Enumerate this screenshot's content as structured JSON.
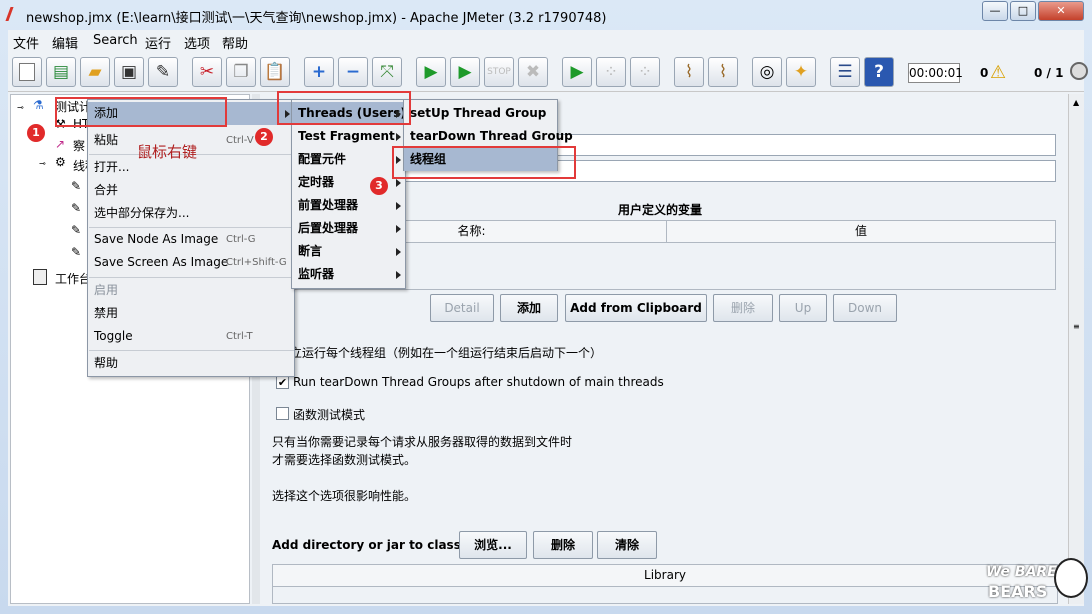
{
  "window": {
    "title": "newshop.jmx (E:\\learn\\接口测试\\一\\天气查询\\newshop.jmx) - Apache JMeter (3.2 r1790748)"
  },
  "menubar": [
    "文件",
    "编辑",
    "Search",
    "运行",
    "选项",
    "帮助"
  ],
  "toolbar": {
    "icons": [
      "new-icon",
      "templates-icon",
      "open-icon",
      "save-icon",
      "save-as-icon",
      "cut-icon",
      "copy-icon",
      "paste-icon",
      "expand-icon",
      "collapse-icon",
      "toggle-icon",
      "start-icon",
      "start-no-pause-icon",
      "stop-icon",
      "shutdown-icon",
      "remote-start-icon",
      "remote-stop-icon",
      "remote-shutdown-icon",
      "clear-icon",
      "clear-all-icon",
      "search-icon",
      "reset-search-icon",
      "function-helper-icon",
      "help-icon"
    ],
    "timer": "00:00:01",
    "warning_count": "0",
    "threads": "0 / 1"
  },
  "tree": {
    "nodes": [
      "测试计",
      "HT",
      "察",
      "线程",
      "工作台"
    ]
  },
  "context_menu": {
    "items": [
      {
        "label": "添加",
        "submenu": true
      },
      {
        "label": "粘贴",
        "shortcut": "Ctrl-V"
      },
      {
        "label": "打开..."
      },
      {
        "label": "合并"
      },
      {
        "label": "选中部分保存为..."
      },
      {
        "label": "Save Node As Image",
        "shortcut": "Ctrl-G"
      },
      {
        "label": "Save Screen As Image",
        "shortcut": "Ctrl+Shift-G"
      },
      {
        "label": "启用",
        "disabled": true
      },
      {
        "label": "禁用"
      },
      {
        "label": "Toggle",
        "shortcut": "Ctrl-T"
      },
      {
        "label": "帮助"
      }
    ]
  },
  "add_submenu": {
    "items": [
      "Threads (Users)",
      "Test Fragment",
      "配置元件",
      "定时器",
      "前置处理器",
      "后置处理器",
      "断言",
      "监听器"
    ]
  },
  "threads_submenu": {
    "items": [
      "setUp Thread Group",
      "tearDown Thread Group",
      "线程组"
    ]
  },
  "annotations": {
    "right_click_note": "鼠标右键",
    "badge1": "1",
    "badge2": "2",
    "badge3": "3"
  },
  "test_plan": {
    "variables_title": "用户定义的变量",
    "col_name": "名称:",
    "col_value": "值",
    "buttons": {
      "detail": "Detail",
      "add": "添加",
      "clipboard": "Add from Clipboard",
      "delete": "删除",
      "up": "Up",
      "down": "Down"
    },
    "serial_label": "独立运行每个线程组（例如在一个组运行结束后启动下一个）",
    "teardown_label": "Run tearDown Thread Groups after shutdown of main threads",
    "teardown_checked": true,
    "functional_label": "函数测试模式",
    "functional_checked": false,
    "note_line1": "只有当你需要记录每个请求从服务器取得的数据到文件时",
    "note_line2": "才需要选择函数测试模式。",
    "note_line3": "选择这个选项很影响性能。",
    "classpath_label": "Add directory or jar to classpath",
    "browse": "浏览...",
    "cp_delete": "删除",
    "cp_clear": "清除",
    "library_header": "Library"
  },
  "logo": {
    "text1": "We BARE",
    "text2": "BEARS"
  }
}
